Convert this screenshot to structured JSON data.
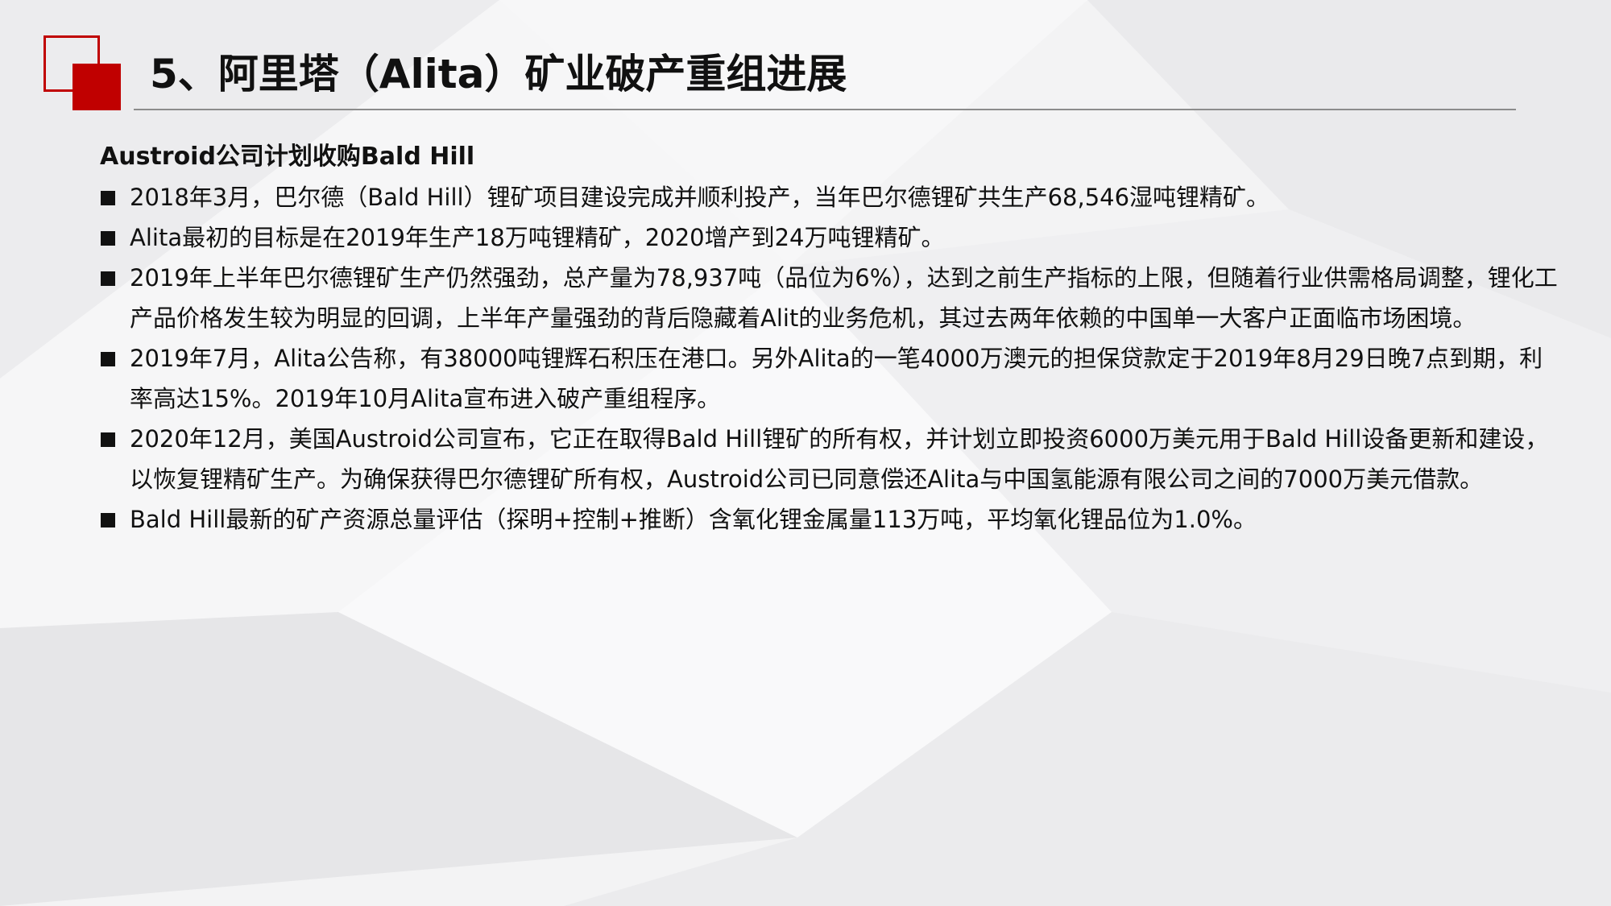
{
  "slide": {
    "title": "5、阿里塔（Alita）矿业破产重组进展",
    "subheading": "Austroid公司计划收购Bald Hill",
    "bullets": [
      "2018年3月，巴尔德（Bald Hill）锂矿项目建设完成并顺利投产，当年巴尔德锂矿共生产68,546湿吨锂精矿。",
      "Alita最初的目标是在2019年生产18万吨锂精矿，2020增产到24万吨锂精矿。",
      "2019年上半年巴尔德锂矿生产仍然强劲，总产量为78,937吨（品位为6%），达到之前生产指标的上限，但随着行业供需格局调整，锂化工产品价格发生较为明显的回调，上半年产量强劲的背后隐藏着Alit的业务危机，其过去两年依赖的中国单一大客户正面临市场困境。",
      "2019年7月，Alita公告称，有38000吨锂辉石积压在港口。另外Alita的一笔4000万澳元的担保贷款定于2019年8月29日晚7点到期，利率高达15%。2019年10月Alita宣布进入破产重组程序。",
      "2020年12月，美国Austroid公司宣布，它正在取得Bald  Hill锂矿的所有权，并计划立即投资6000万美元用于Bald  Hill设备更新和建设，以恢复锂精矿生产。为确保获得巴尔德锂矿所有权，Austroid公司已同意偿还Alita与中国氢能源有限公司之间的7000万美元借款。",
      "Bald Hill最新的矿产资源总量评估（探明+控制+推断）含氧化锂金属量113万吨，平均氧化锂品位为1.0%。"
    ]
  },
  "colors": {
    "accent": "#c00000",
    "text": "#111111",
    "rule": "#8c8c8c",
    "background": "#f2f2f3"
  },
  "icons": {
    "logo": "red-squares-logo",
    "bullet": "black-square-bullet"
  }
}
